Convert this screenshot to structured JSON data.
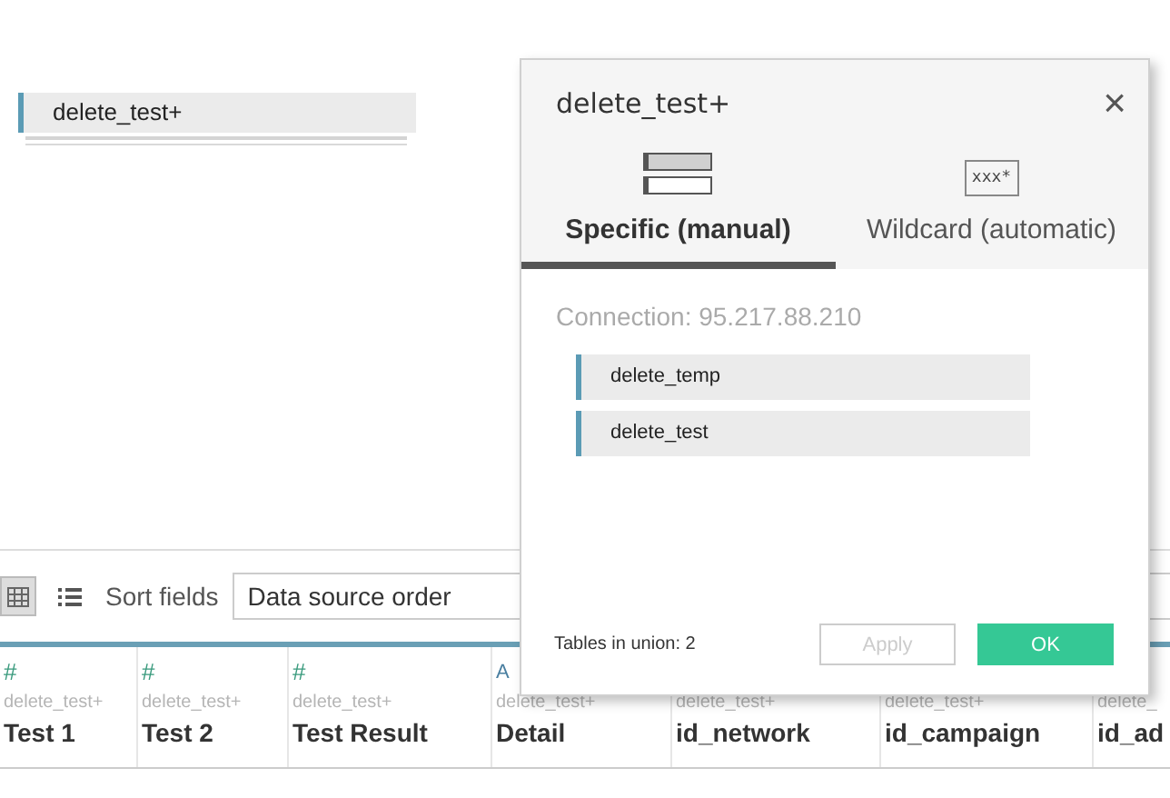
{
  "canvas": {
    "table_pill": "delete_test+"
  },
  "toolbar": {
    "views": [
      {
        "kind": "grid",
        "selected": true
      },
      {
        "kind": "list",
        "selected": false
      }
    ],
    "sort_label": "Sort fields",
    "sort_value": "Data source order"
  },
  "columns": [
    {
      "type": "#",
      "source": "delete_test+",
      "name": "Test 1"
    },
    {
      "type": "#",
      "source": "delete_test+",
      "name": "Test 2"
    },
    {
      "type": "#",
      "source": "delete_test+",
      "name": "Test Result"
    },
    {
      "type": "A",
      "source": "delete_test+",
      "name": "Detail"
    },
    {
      "source": "delete_test+",
      "name": "id_network"
    },
    {
      "source": "delete_test+",
      "name": "id_campaign"
    },
    {
      "source": "delete_",
      "name": "id_ad"
    }
  ],
  "dialog": {
    "title": "delete_test+",
    "close": "×",
    "tabs": [
      {
        "kind": "manual",
        "label": "Specific (manual)",
        "selected": true
      },
      {
        "kind": "wildcard",
        "label": "Wildcard (automatic)",
        "icon_text": "xxx*",
        "selected": false
      }
    ],
    "connection": "Connection: 95.217.88.210",
    "tables": [
      "delete_temp",
      "delete_test"
    ],
    "count": "Tables in union: 2",
    "buttons": [
      {
        "label": "Apply",
        "kind": "secondary",
        "disabled": true
      },
      {
        "label": "OK",
        "kind": "primary",
        "disabled": false
      }
    ]
  }
}
